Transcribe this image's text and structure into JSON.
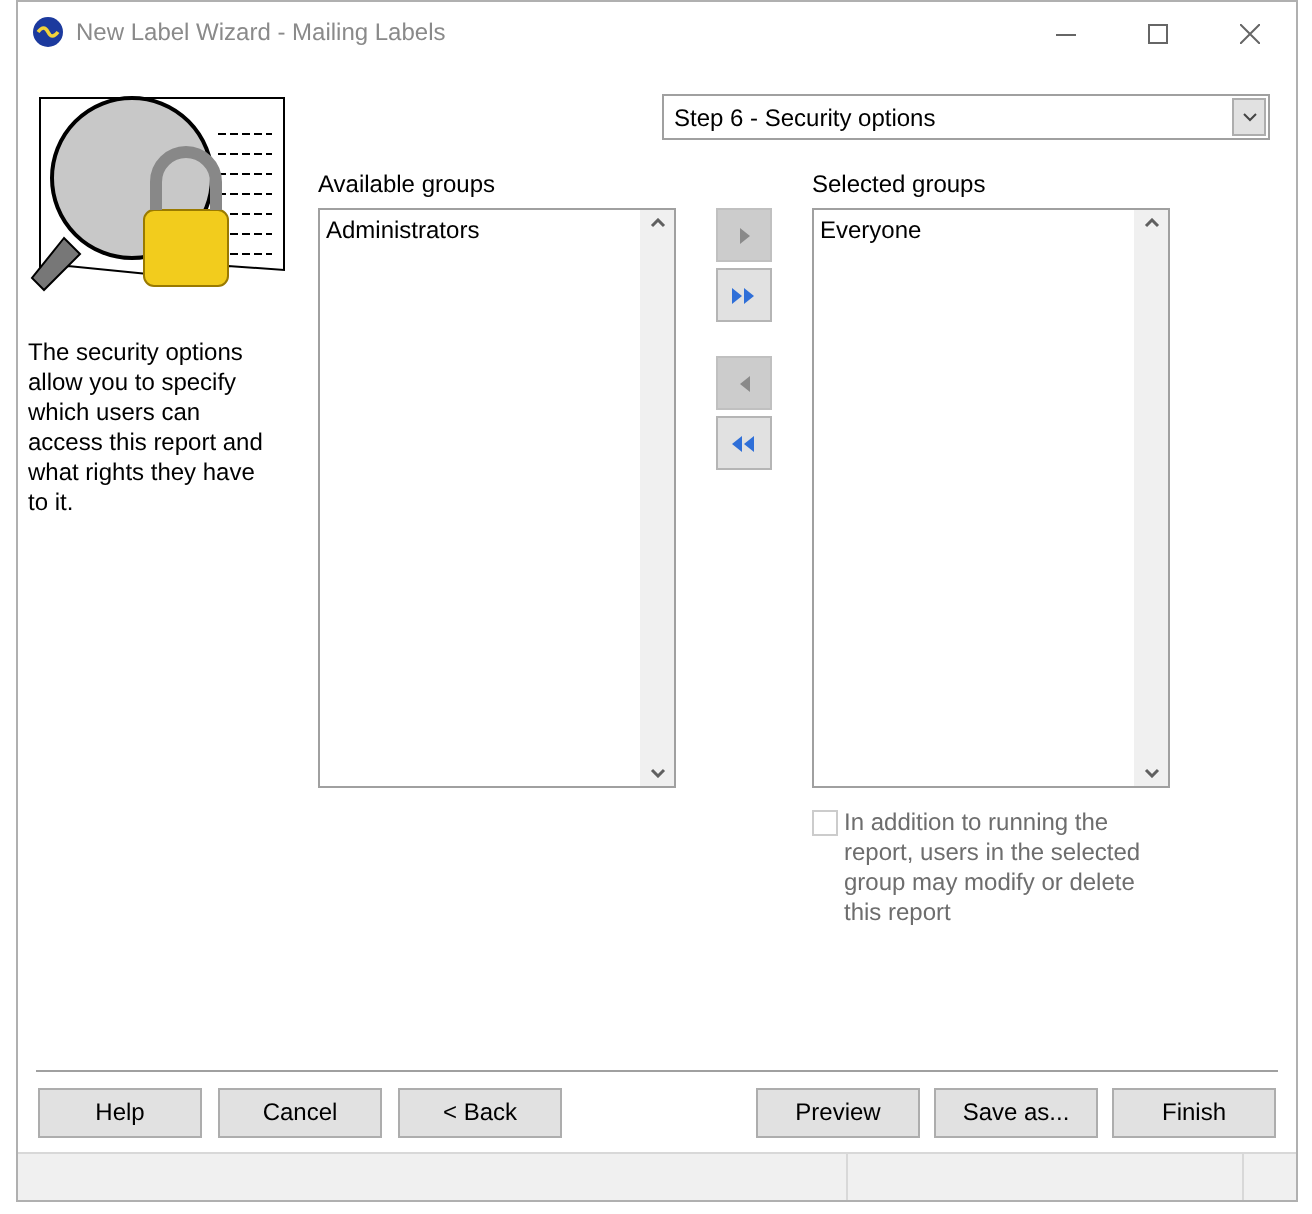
{
  "window": {
    "title": "New Label Wizard - Mailing Labels"
  },
  "description": "The security options allow you to specify which users can access this report and what rights they have to it.",
  "step_select": {
    "value": "Step 6 - Security options"
  },
  "available": {
    "label": "Available groups",
    "items": [
      "Administrators"
    ]
  },
  "move_buttons": [
    {
      "kind": "add",
      "disabled": true
    },
    {
      "kind": "add_all",
      "disabled": false
    },
    {
      "kind": "remove",
      "disabled": true
    },
    {
      "kind": "remove_all",
      "disabled": false
    }
  ],
  "selected": {
    "label": "Selected groups",
    "items": [
      "Everyone"
    ]
  },
  "modify_option": {
    "label": "In addition to running the report, users in the selected group may modify or delete this report",
    "checked": false,
    "disabled": true
  },
  "buttons_left": [
    "Help",
    "Cancel",
    "< Back"
  ],
  "buttons_right": [
    "Preview",
    "Save as...",
    "Finish"
  ]
}
